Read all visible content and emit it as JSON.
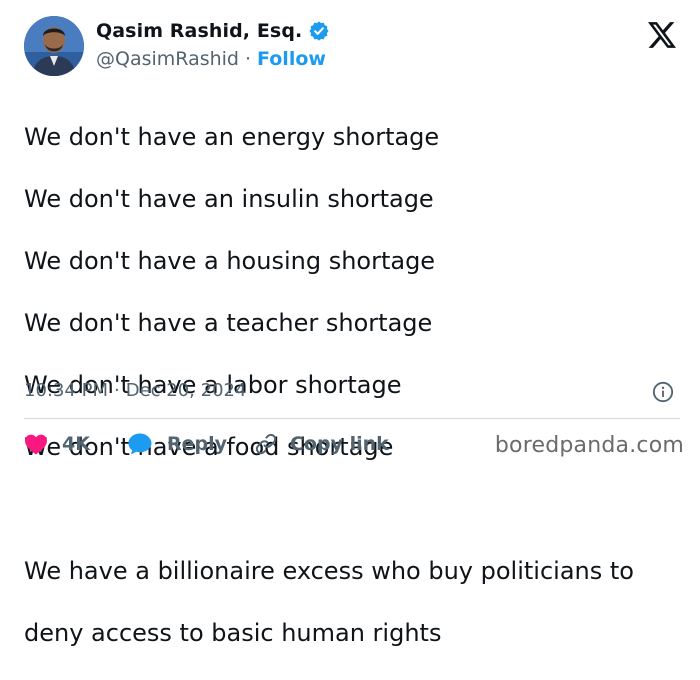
{
  "author": {
    "display_name": "Qasim Rashid, Esq.",
    "handle": "@QasimRashid",
    "separator": "·",
    "follow_label": "Follow",
    "verified": true,
    "avatar_icon": "user-avatar"
  },
  "tweet": {
    "lines": [
      "We don't have an energy shortage",
      "We don't have an insulin shortage",
      "We don't have a housing shortage",
      "We don't have a teacher shortage",
      "We don't have a labor shortage",
      "We don't have a food shortage",
      "",
      "We have a billionaire excess who buy politicians to",
      "deny access to basic human rights"
    ],
    "time": "10:34 PM",
    "separator": "·",
    "date": "Dec 20, 2024"
  },
  "actions": {
    "like_count": "4K",
    "reply_label": "Reply",
    "copy_link_label": "Copy link"
  },
  "branding": {
    "platform_icon": "x-logo",
    "watermark": "boredpanda.com"
  },
  "colors": {
    "link_blue": "#1d9bf0",
    "like_red": "#f91880",
    "secondary_text": "#536471",
    "primary_text": "#0f1419"
  }
}
